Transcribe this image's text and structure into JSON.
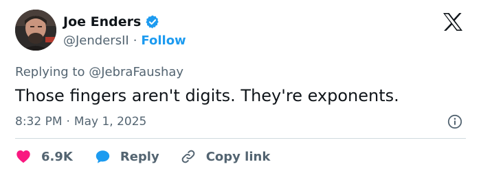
{
  "author": {
    "name": "Joe Enders",
    "handle": "@JendersII",
    "follow_label": "Follow",
    "separator": "·",
    "verified": true
  },
  "reply": {
    "prefix": "Replying to",
    "mention": "@JebraFaushay"
  },
  "tweet": {
    "text": "Those fingers aren't digits. They're exponents."
  },
  "meta": {
    "time": "8:32 PM",
    "separator": "·",
    "date": "May 1, 2025"
  },
  "actions": {
    "likes": "6.9K",
    "reply_label": "Reply",
    "copy_label": "Copy link"
  },
  "colors": {
    "accent": "#1d9bf0",
    "like": "#f91880",
    "text": "#0f1419",
    "muted": "#536471",
    "divider": "#cfd9de"
  },
  "icons": {
    "verified": "verified-badge-icon",
    "brand": "x-logo-icon",
    "info": "info-icon",
    "like": "heart-icon",
    "reply": "speech-bubble-icon",
    "copy": "link-icon"
  }
}
